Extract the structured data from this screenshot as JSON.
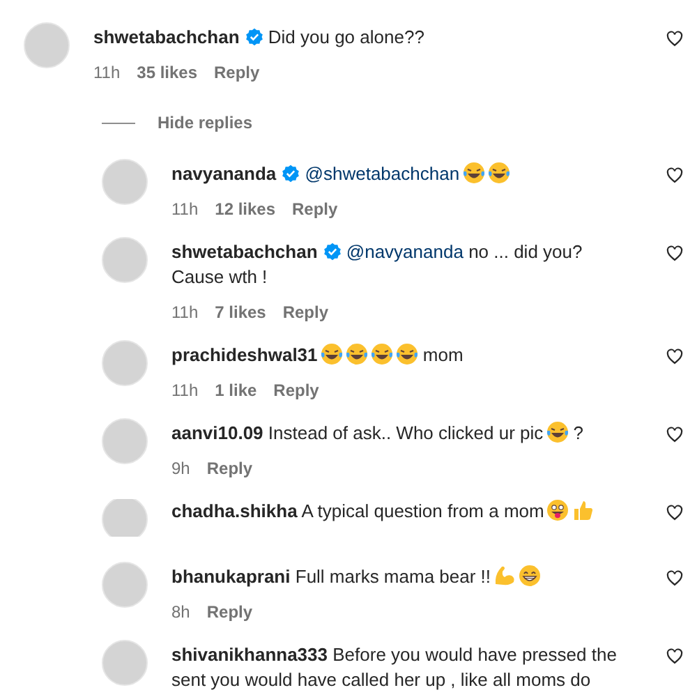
{
  "comments": [
    {
      "username": "shwetabachchan",
      "verified": true,
      "reply": false,
      "clipped": false,
      "body": [
        {
          "kind": "text",
          "text": "Did you go alone??"
        }
      ],
      "time": "11h",
      "likes": "35 likes",
      "reply_label": "Reply",
      "liked": false
    },
    {
      "kind": "toggle",
      "label": "Hide replies"
    },
    {
      "username": "navyananda",
      "verified": true,
      "reply": true,
      "clipped": false,
      "body": [
        {
          "kind": "mention",
          "text": "@shwetabachchan"
        },
        {
          "kind": "laugh"
        },
        {
          "kind": "laugh"
        }
      ],
      "time": "11h",
      "likes": "12 likes",
      "reply_label": "Reply",
      "liked": false
    },
    {
      "username": "shwetabachchan",
      "verified": true,
      "reply": true,
      "clipped": false,
      "body": [
        {
          "kind": "mention",
          "text": "@navyananda"
        },
        {
          "kind": "text",
          "text": "no ... did you? Cause wth !"
        }
      ],
      "time": "11h",
      "likes": "7 likes",
      "reply_label": "Reply",
      "liked": false
    },
    {
      "username": "prachideshwal31",
      "verified": false,
      "reply": true,
      "clipped": false,
      "body": [
        {
          "kind": "laugh"
        },
        {
          "kind": "laugh"
        },
        {
          "kind": "laugh"
        },
        {
          "kind": "laugh"
        },
        {
          "kind": "text",
          "text": "mom"
        }
      ],
      "time": "11h",
      "likes": "1 like",
      "reply_label": "Reply",
      "liked": false
    },
    {
      "username": "aanvi10.09",
      "verified": false,
      "reply": true,
      "clipped": false,
      "body": [
        {
          "kind": "text",
          "text": "Instead of ask.. Who clicked ur pic"
        },
        {
          "kind": "laugh"
        },
        {
          "kind": "text",
          "text": "?"
        }
      ],
      "time": "9h",
      "reply_label": "Reply",
      "liked": false
    },
    {
      "username": "chadha.shikha",
      "verified": false,
      "reply": true,
      "clipped": true,
      "body": [
        {
          "kind": "text",
          "text": "A typical question from a mom"
        },
        {
          "kind": "tongue"
        },
        {
          "kind": "thumbs"
        }
      ],
      "liked": false
    },
    {
      "username": "bhanukaprani",
      "verified": false,
      "reply": true,
      "clipped": false,
      "body": [
        {
          "kind": "text",
          "text": "Full marks mama bear !!"
        },
        {
          "kind": "muscle"
        },
        {
          "kind": "grin"
        }
      ],
      "time": "8h",
      "reply_label": "Reply",
      "liked": false
    },
    {
      "username": "shivanikhanna333",
      "verified": false,
      "reply": true,
      "clipped": false,
      "body": [
        {
          "kind": "text",
          "text": "Before you would have pressed the sent you would have called her up , like all moms do"
        }
      ],
      "liked": false
    }
  ]
}
